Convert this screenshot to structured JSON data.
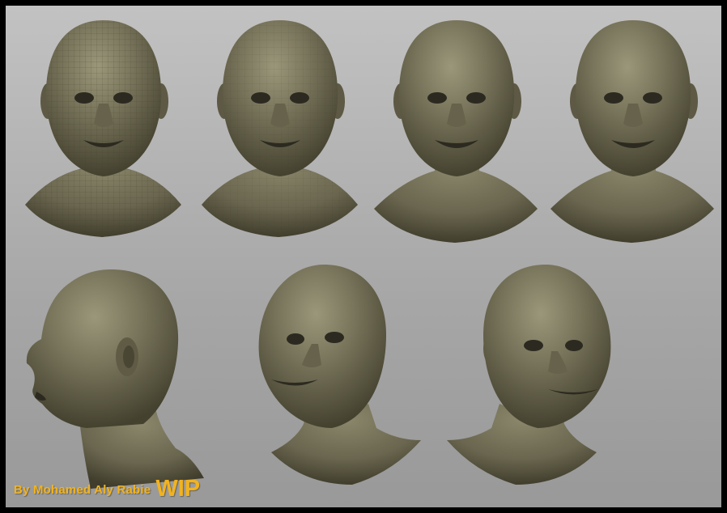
{
  "credit": {
    "author": "By Mohamed Aly Rabie",
    "tag": "WIP"
  },
  "colors": {
    "background_top": "#c2c2c2",
    "background_bottom": "#999999",
    "clay": "#6f6b52",
    "credit_text": "#f2b31e"
  },
  "views": [
    {
      "id": "front-wireframe-1",
      "angle": "front",
      "wireframe": "dense"
    },
    {
      "id": "front-wireframe-2",
      "angle": "front",
      "wireframe": "light"
    },
    {
      "id": "front-smooth-1",
      "angle": "front",
      "wireframe": "none"
    },
    {
      "id": "front-smooth-2",
      "angle": "front",
      "wireframe": "none"
    },
    {
      "id": "side-profile",
      "angle": "left profile",
      "wireframe": "none"
    },
    {
      "id": "three-quarter-left",
      "angle": "three-quarter left",
      "wireframe": "none"
    },
    {
      "id": "three-quarter-right",
      "angle": "three-quarter right",
      "wireframe": "none"
    }
  ]
}
